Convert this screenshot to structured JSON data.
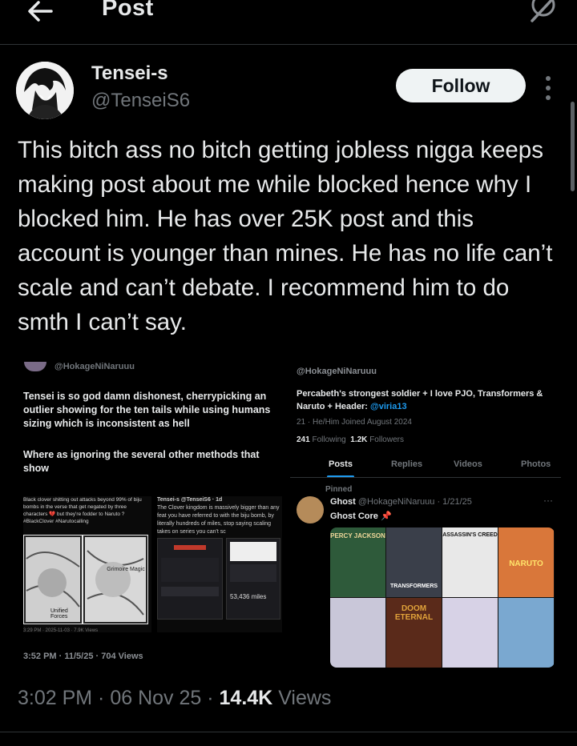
{
  "header": {
    "title": "Post"
  },
  "author": {
    "name": "Tensei-s",
    "handle": "@TenseiS6",
    "follow_label": "Follow"
  },
  "post": {
    "text": "This bitch ass no bitch getting jobless nigga keeps making post about me while blocked hence why I blocked him. He has over 25K post and this account is younger than mines. He has no life can’t scale and can’t debate. I recommend him to do smth I can’t say.",
    "time": "3:02 PM",
    "date": "06 Nov 25",
    "views_count": "14.4K",
    "views_label": "Views"
  },
  "media_left": {
    "handle": "@HokageNiNaruuu",
    "text1": "Tensei is so god damn dishonest, cherrypicking an outlier showing for the ten tails while using humans sizing which is inconsistent as hell",
    "text2": "Where as ignoring the several other methods that show",
    "sub_caption": "Black clover shitting out attacks beyond 99% of biju bombs in the verse that get negated by three characters 💔 but they're fodder to Naruto ? #BlackClover #Narutocalling",
    "manga_overlay": "Grimoire Magic",
    "manga_label": "Unified Forces",
    "sub_foot": "3:29 PM · 2025-11-03 · 7.9K Views",
    "sub_right_handle": "Tensei-s @TenseiS6 · 1d",
    "sub_right_text": "The Clover kingdom is massively bigger than any feat you have referred to with the biju bomb, by literally hundreds of miles, stop saying scaling takes on series you can't sc",
    "miles": "53,436 miles",
    "meta": "3:52 PM · 11/5/25 · 704 Views"
  },
  "media_right": {
    "handle": "@HokageNiNaruuu",
    "bio_text": "Percabeth's strongest soldier + I love PJO, Transformers & Naruto + Header: ",
    "bio_link": "@viria13",
    "info": "21 · He/Him    Joined August 2024",
    "following_count": "241",
    "following_label": "Following",
    "followers_count": "1.2K",
    "followers_label": "Followers",
    "tabs": [
      "Posts",
      "Replies",
      "Videos",
      "Photos"
    ],
    "pinned_label": "Pinned",
    "pin_name": "Ghost",
    "pin_meta": "@HokageNiNaruuu · 1/21/25",
    "pin_text": "Ghost Core 📌",
    "posters": [
      "PERCY JACKSON",
      "TRANSFORMERS",
      "ASSASSIN'S CREED",
      "NARUTO",
      "",
      "DOOM ETERNAL",
      "",
      ""
    ]
  }
}
